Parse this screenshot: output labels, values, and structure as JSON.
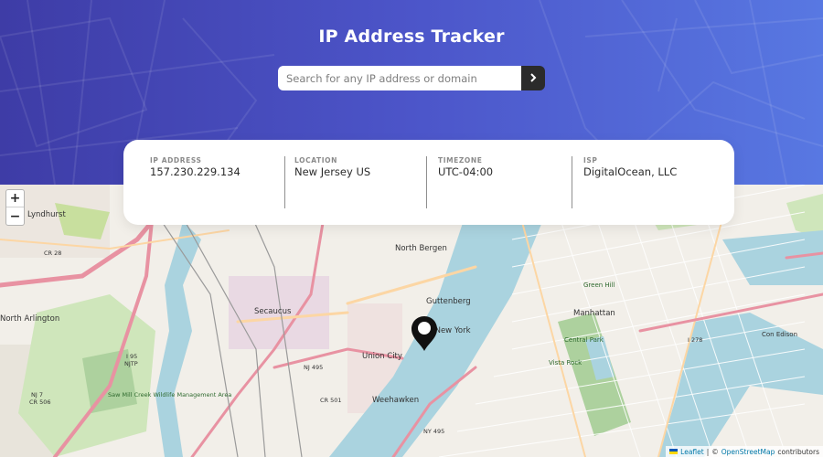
{
  "header": {
    "title": "IP Address Tracker",
    "search_placeholder": "Search for any IP address or domain",
    "colors": {
      "gradient_start": "#3e3ca6",
      "gradient_end": "#5878e2",
      "button": "#2b2b2b"
    }
  },
  "search_button_icon": "chevron-right-icon",
  "stats": [
    {
      "label": "IP ADDRESS",
      "value": "157.230.229.134"
    },
    {
      "label": "LOCATION",
      "value": "New Jersey US"
    },
    {
      "label": "TIMEZONE",
      "value": "UTC-04:00"
    },
    {
      "label": "ISP",
      "value": "DigitalOcean, LLC"
    }
  ],
  "map": {
    "zoom_in": "+",
    "zoom_out": "−",
    "marker_icon": "location-pin-icon",
    "labels": {
      "lyndhurst": "Lyndhurst",
      "cr28": "CR 28",
      "north_bergen": "North Bergen",
      "guttenberg": "Guttenberg",
      "secaucus": "Secaucus",
      "north_arlington": "North Arlington",
      "west_new_york": "West New York",
      "union_city": "Union City",
      "weehawken": "Weehawken",
      "manhattan": "Manhattan",
      "central_park": "Central Park",
      "vista_rock": "Vista Rock",
      "green_hill": "Green Hill",
      "con_edison": "Con Edison",
      "nj495": "NJ 495",
      "ny495": "NY 495",
      "cr501": "CR 501",
      "i95": "I 95",
      "njtp": "NJTP",
      "i278": "I 278",
      "cr506": "CR 506",
      "nj7": "NJ 7",
      "sawmill": "Saw Mill Creek Wildlife Management Area"
    },
    "attribution": {
      "leaflet": "Leaflet",
      "separator": "|",
      "copyright": "©",
      "osm": "OpenStreetMap",
      "contributors": "contributors"
    }
  }
}
